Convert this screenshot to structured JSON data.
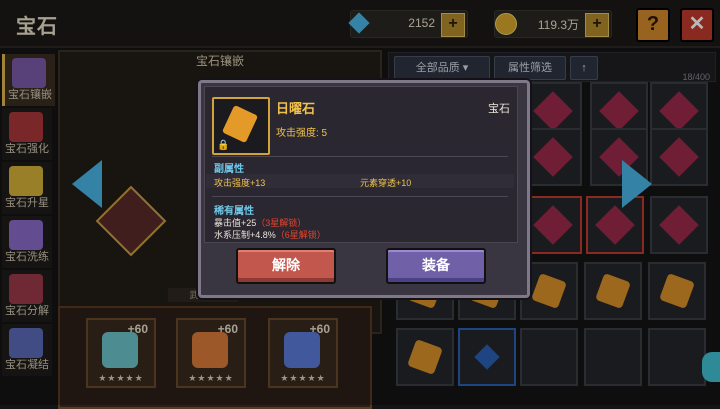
{
  "header": {
    "title": "宝石",
    "diamonds": "2152",
    "gold": "119.3万",
    "help_label": "?",
    "close_label": "✕"
  },
  "sidebar": {
    "items": [
      {
        "label": "宝石镶嵌",
        "icon": "gem-inlay-icon",
        "color": "#7a5aa8"
      },
      {
        "label": "宝石强化",
        "icon": "gem-enhance-icon",
        "color": "#a8363a"
      },
      {
        "label": "宝石升星",
        "icon": "gem-star-icon",
        "color": "#d6b03a"
      },
      {
        "label": "宝石洗练",
        "icon": "gem-reroll-icon",
        "color": "#8a6ac8"
      },
      {
        "label": "宝石分解",
        "icon": "gem-decompose-icon",
        "color": "#9a3a4a"
      },
      {
        "label": "宝石凝结",
        "icon": "gem-condense-icon",
        "color": "#5a6ab8"
      }
    ]
  },
  "socket": {
    "title": "宝石镶嵌",
    "weapon_label": "武器栏",
    "slots": [
      {
        "level": "+60",
        "stars": "★★★★★",
        "color": "#6bc2c8"
      },
      {
        "level": "+60",
        "stars": "★★★★★",
        "color": "#d97a3a"
      },
      {
        "level": "+60",
        "stars": "★★★★★",
        "color": "#5a7ad8"
      }
    ]
  },
  "filters": {
    "quality": "全部品质",
    "attribute": "属性筛选",
    "sort": "↑",
    "count": "18/400"
  },
  "item": {
    "name": "日曜石",
    "type": "宝石",
    "main_stat": "攻击强度: 5",
    "sub_title": "副属性",
    "sub_stats": [
      "攻击强度+13",
      "元素穿透+10"
    ],
    "rare_title": "稀有属性",
    "rare_stats": [
      {
        "text": "暴击值+25",
        "lock": "（3星解锁）"
      },
      {
        "text": "水系压制+4.8%",
        "lock": "（6星解锁）"
      }
    ],
    "remove_label": "解除",
    "equip_label": "装备"
  },
  "colors": {
    "accent_gold": "#f0c24b",
    "accent_blue": "#49b6e6",
    "remove": "#c2574d",
    "equip": "#6f60a8"
  }
}
